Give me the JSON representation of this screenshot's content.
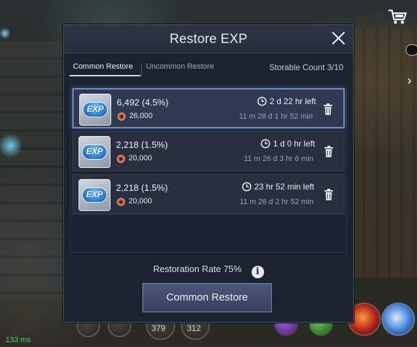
{
  "dialog": {
    "title": "Restore EXP",
    "close_icon": "close-icon"
  },
  "tabs": [
    {
      "label": "Common Restore",
      "active": true
    },
    {
      "label": "Uncommon Restore",
      "active": false
    }
  ],
  "storable_count": "Storable Count 3/10",
  "entries": [
    {
      "exp": "6,492 (4.5%)",
      "cost": "26,000",
      "time_left": "2 d 22 hr left",
      "expires": "11 m 28 d 1 hr 52 min",
      "selected": true
    },
    {
      "exp": "2,218 (1.5%)",
      "cost": "20,000",
      "time_left": "1 d 0 hr left",
      "expires": "11 m 26 d 3 hr 6 min",
      "selected": false
    },
    {
      "exp": "2,218 (1.5%)",
      "cost": "20,000",
      "time_left": "23 hr 52 min left",
      "expires": "11 m 26 d 2 hr 52 min",
      "selected": false
    }
  ],
  "exp_icon_label": "EXP",
  "restoration_rate": "Restoration Rate 75%",
  "info_label": "i",
  "restore_button": "Common Restore",
  "hud": {
    "skill_counts": [
      "379",
      "312"
    ],
    "ping": "133 ms"
  },
  "colors": {
    "modal_bg": "#1c2330",
    "selected_border": "#6f8fc4",
    "button_bg": "#414d6c"
  }
}
